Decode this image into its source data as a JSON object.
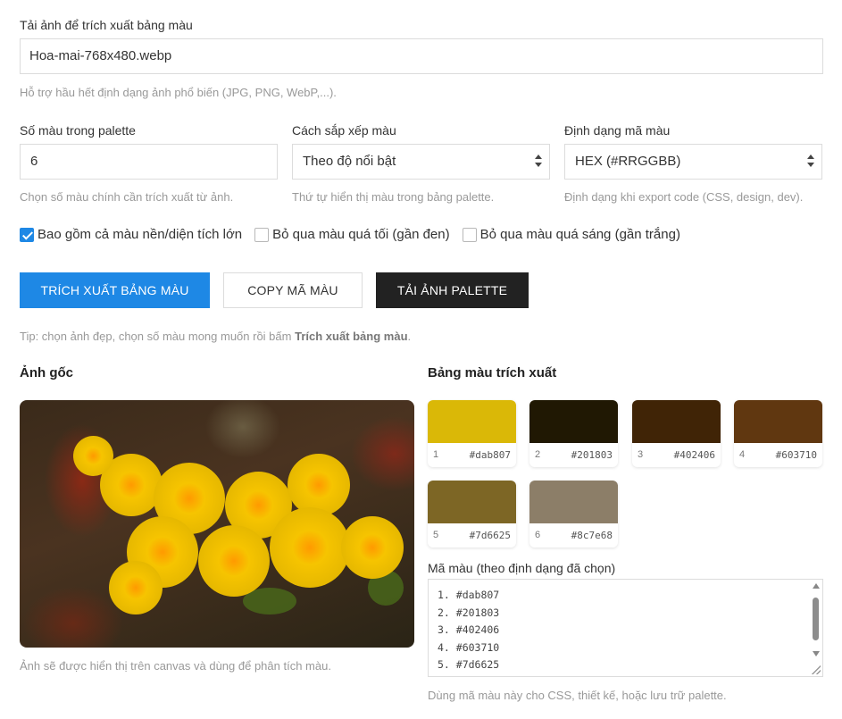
{
  "upload": {
    "label": "Tải ảnh để trích xuất bảng màu",
    "filename": "Hoa-mai-768x480.webp",
    "help": "Hỗ trợ hầu hết định dạng ảnh phổ biến (JPG, PNG, WebP,...)."
  },
  "settings": {
    "count": {
      "label": "Số màu trong palette",
      "value": "6",
      "help": "Chọn số màu chính cần trích xuất từ ảnh."
    },
    "sort": {
      "label": "Cách sắp xếp màu",
      "value": "Theo độ nổi bật",
      "help": "Thứ tự hiển thị màu trong bảng palette."
    },
    "format": {
      "label": "Định dạng mã màu",
      "value": "HEX (#RRGGBB)",
      "help": "Định dạng khi export code (CSS, design, dev)."
    }
  },
  "options": [
    {
      "label": "Bao gồm cả màu nền/diện tích lớn",
      "checked": true
    },
    {
      "label": "Bỏ qua màu quá tối (gần đen)",
      "checked": false
    },
    {
      "label": "Bỏ qua màu quá sáng (gần trắng)",
      "checked": false
    }
  ],
  "buttons": {
    "extract": "TRÍCH XUẤT BẢNG MÀU",
    "copy": "COPY MÃ MÀU",
    "download": "TẢI ẢNH PALETTE"
  },
  "tip": {
    "prefix": "Tip: chọn ảnh đẹp, chọn số màu mong muốn rồi bấm ",
    "bold": "Trích xuất bảng màu",
    "suffix": "."
  },
  "image_section": {
    "title": "Ảnh gốc",
    "caption": "Ảnh sẽ được hiển thị trên canvas và dùng để phân tích màu."
  },
  "palette_section": {
    "title": "Bảng màu trích xuất",
    "swatches": [
      {
        "index": "1",
        "hex": "#dab807"
      },
      {
        "index": "2",
        "hex": "#201803"
      },
      {
        "index": "3",
        "hex": "#402406"
      },
      {
        "index": "4",
        "hex": "#603710"
      },
      {
        "index": "5",
        "hex": "#7d6625"
      },
      {
        "index": "6",
        "hex": "#8c7e68"
      }
    ]
  },
  "codes": {
    "label": "Mã màu (theo định dạng đã chọn)",
    "lines": [
      "1. #dab807",
      "2. #201803",
      "3. #402406",
      "4. #603710",
      "5. #7d6625"
    ],
    "help": "Dùng mã màu này cho CSS, thiết kế, hoặc lưu trữ palette."
  }
}
